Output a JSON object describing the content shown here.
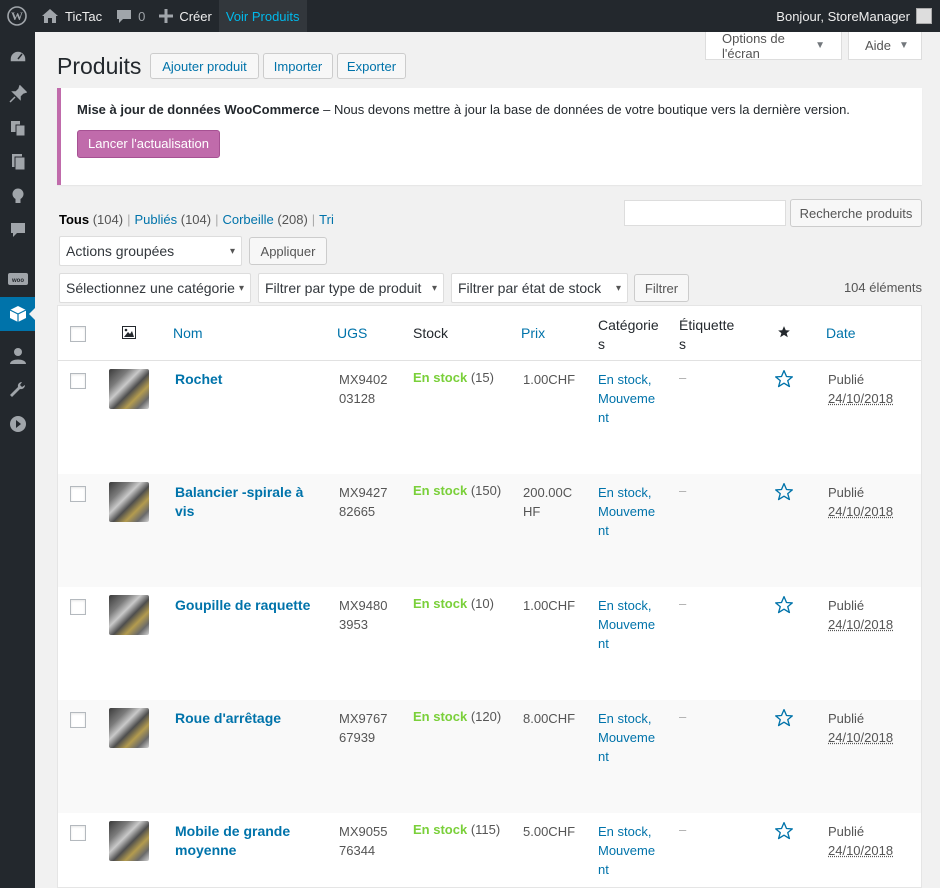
{
  "adminbar": {
    "site_name": "TicTac",
    "comments_count": "0",
    "new_label": "Créer",
    "view_products": "Voir Produits",
    "greeting": "Bonjour, StoreManager"
  },
  "screen_options": {
    "label": "Options de l'écran",
    "help": "Aide"
  },
  "page": {
    "title": "Produits",
    "buttons": {
      "add": "Ajouter produit",
      "import": "Importer",
      "export": "Exporter"
    }
  },
  "notice": {
    "strong": "Mise à jour de données WooCommerce",
    "text": " – Nous devons mettre à jour la base de données de votre boutique vers la dernière version.",
    "button": "Lancer l'actualisation"
  },
  "views": {
    "all_label": "Tous",
    "all_count": "(104)",
    "published_label": "Publiés",
    "published_count": "(104)",
    "trash_label": "Corbeille",
    "trash_count": "(208)",
    "sort_label": "Tri"
  },
  "search": {
    "button": "Recherche produits"
  },
  "bulk": {
    "select": "Actions groupées",
    "apply": "Appliquer"
  },
  "filters": {
    "category": "Sélectionnez une catégorie",
    "type": "Filtrer par type de produit",
    "stock": "Filtrer par état de stock",
    "button": "Filtrer",
    "count": "104 éléments"
  },
  "columns": {
    "name": "Nom",
    "sku": "UGS",
    "stock": "Stock",
    "price": "Prix",
    "categories": "Catégories",
    "tags": "Étiquettes",
    "date": "Date"
  },
  "rows": [
    {
      "name": "Rochet",
      "sku": "MX940203128",
      "stock": "En stock",
      "qty": "(15)",
      "price": "1.00CHF",
      "categories": "En stock, Mouvement",
      "tags": "–",
      "status": "Publié",
      "date": "24/10/2018"
    },
    {
      "name": "Balancier -spirale à vis",
      "sku": "MX942782665",
      "stock": "En stock",
      "qty": "(150)",
      "price": "200.00CHF",
      "categories": "En stock, Mouvement",
      "tags": "–",
      "status": "Publié",
      "date": "24/10/2018"
    },
    {
      "name": "Goupille de raquette",
      "sku": "MX94803953",
      "stock": "En stock",
      "qty": "(10)",
      "price": "1.00CHF",
      "categories": "En stock, Mouvement",
      "tags": "–",
      "status": "Publié",
      "date": "24/10/2018"
    },
    {
      "name": "Roue d'arrêtage",
      "sku": "MX976767939",
      "stock": "En stock",
      "qty": "(120)",
      "price": "8.00CHF",
      "categories": "En stock, Mouvement",
      "tags": "–",
      "status": "Publié",
      "date": "24/10/2018"
    },
    {
      "name": "Mobile de grande moyenne",
      "sku": "MX905576344",
      "stock": "En stock",
      "qty": "(115)",
      "price": "5.00CHF",
      "categories": "En stock, Mouvement",
      "tags": "–",
      "status": "Publié",
      "date": "24/10/2018"
    }
  ],
  "colors": {
    "accent": "#0073aa",
    "woo": "#c06bab",
    "in_stock": "#7ad03a",
    "sidebar": "#23282d"
  }
}
